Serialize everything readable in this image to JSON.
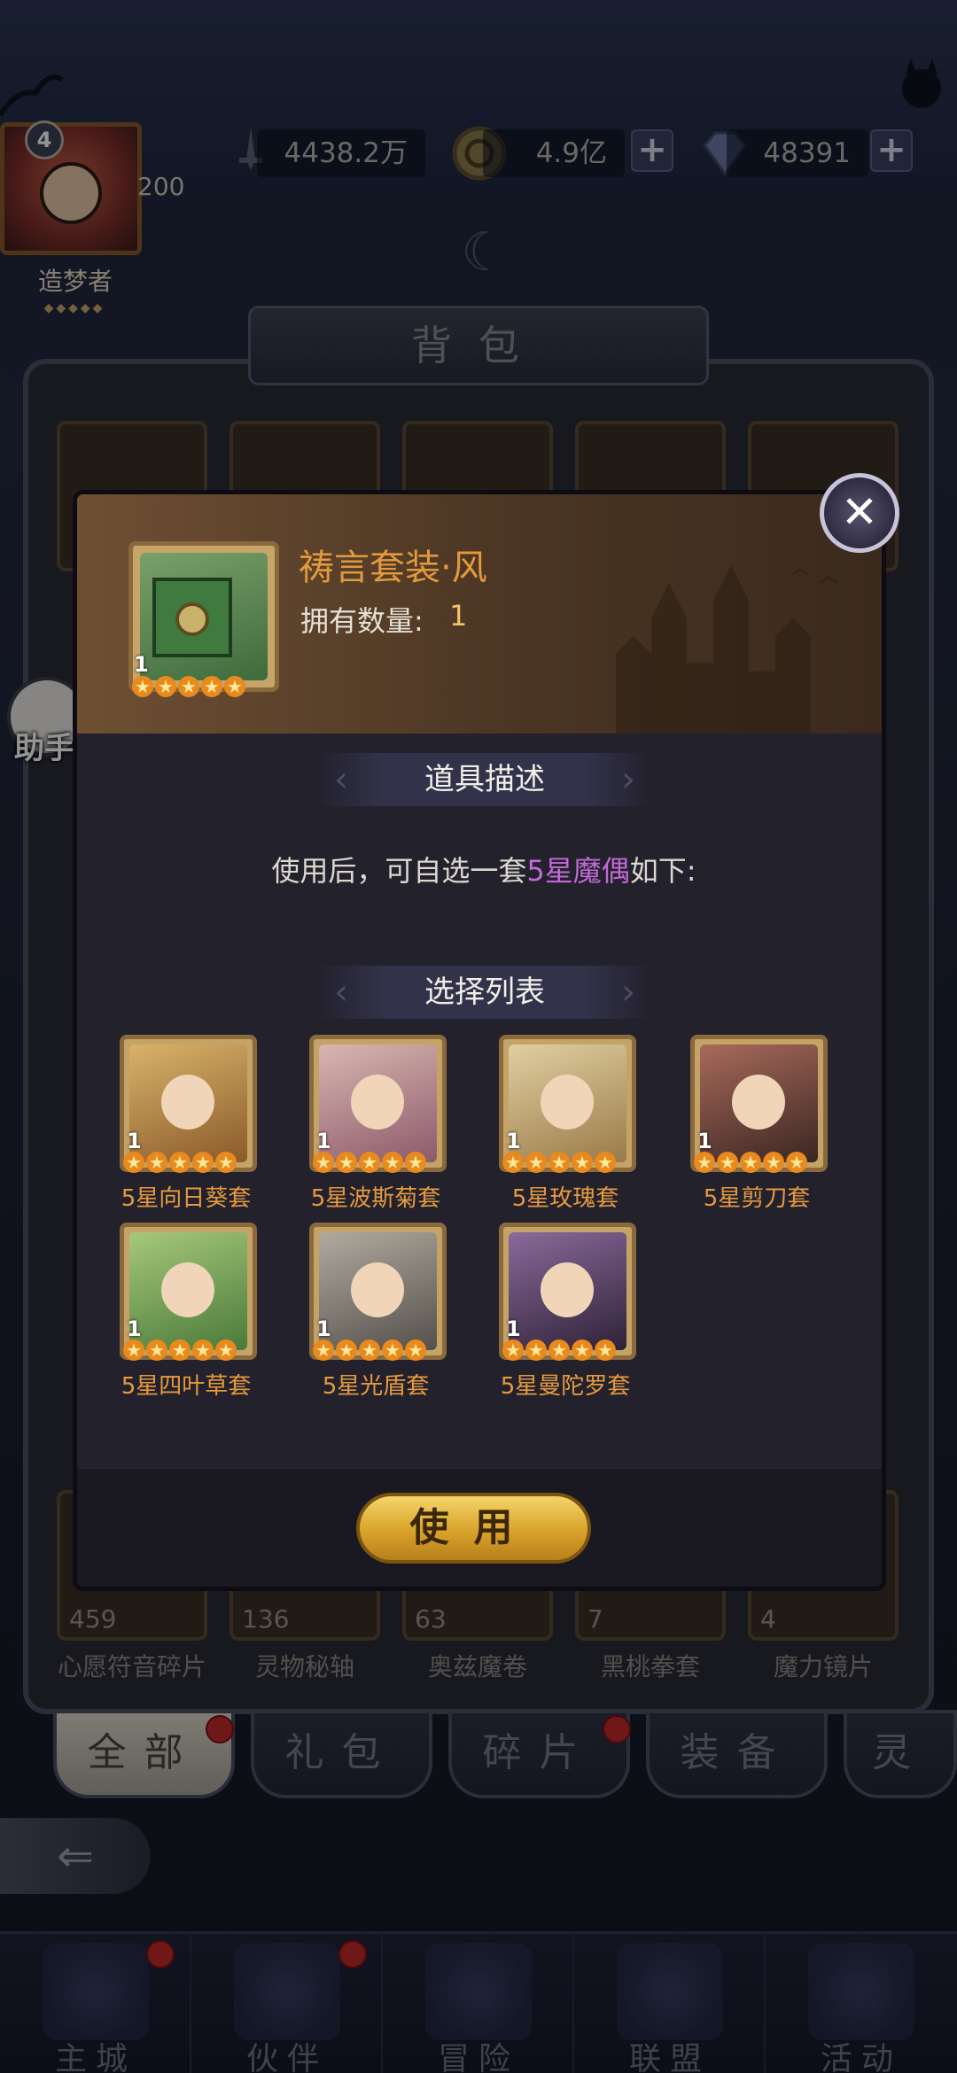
{
  "player": {
    "level": "4",
    "exp": "200",
    "title": "造梦者"
  },
  "resources": {
    "power": "4438.2万",
    "gold": "4.9亿",
    "gems": "48391",
    "plus": "+"
  },
  "bag": {
    "title": "背包",
    "items": [
      {
        "count": "459",
        "label": "心愿符音碎片"
      },
      {
        "count": "136",
        "label": "灵物秘轴"
      },
      {
        "count": "63",
        "label": "奥兹魔卷"
      },
      {
        "count": "7",
        "label": "黑桃拳套"
      },
      {
        "count": "4",
        "label": "魔力镜片"
      }
    ],
    "tabs": [
      "全部",
      "礼包",
      "碎片",
      "装备",
      "灵"
    ],
    "back": "⇐"
  },
  "helper": {
    "label": "助手"
  },
  "modal": {
    "item_name": "祷言套装·风",
    "own_label": "拥有数量:",
    "own_value": "1",
    "icon_count": "1",
    "section_desc": "道具描述",
    "desc_before": "使用后，可自选一套",
    "desc_highlight": "5星魔偶",
    "desc_after": "如下:",
    "section_list": "选择列表",
    "choices": [
      {
        "label": "5星向日葵套",
        "count": "1"
      },
      {
        "label": "5星波斯菊套",
        "count": "1"
      },
      {
        "label": "5星玫瑰套",
        "count": "1"
      },
      {
        "label": "5星剪刀套",
        "count": "1"
      },
      {
        "label": "5星四叶草套",
        "count": "1"
      },
      {
        "label": "5星光盾套",
        "count": "1"
      },
      {
        "label": "5星曼陀罗套",
        "count": "1"
      }
    ],
    "use_button": "使用",
    "close": "✕",
    "star_glyph": "★"
  },
  "nav": [
    "主城",
    "伙伴",
    "冒险",
    "联盟",
    "活动"
  ],
  "colors": {
    "accent_orange": "#e69a3e",
    "highlight_purple": "#c26ad6",
    "gold_button": "#d9a22a"
  }
}
